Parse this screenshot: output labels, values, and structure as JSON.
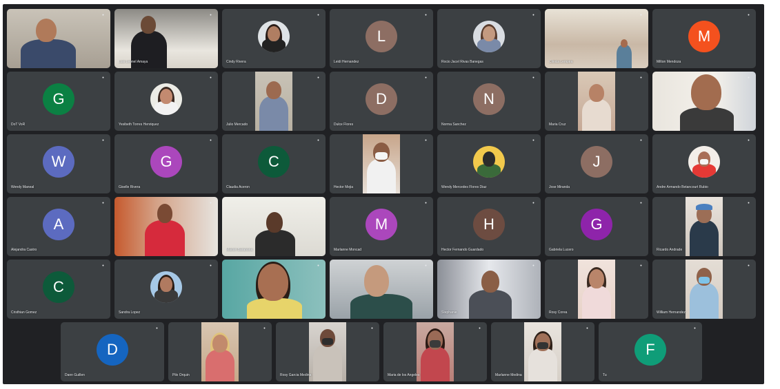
{
  "window": {
    "app": "Video meeting grid"
  },
  "colors": {
    "background": "#202124",
    "tile": "#3c4043",
    "text": "#e8eaed"
  },
  "participants": [
    {
      "name": "",
      "type": "video",
      "style": "office-left"
    },
    {
      "name": "Luis Leonel Amaya",
      "type": "video",
      "style": "office-desk"
    },
    {
      "name": "Cindy Rivera",
      "type": "photo",
      "style": "woman-dark"
    },
    {
      "name": "Leidi Hernandez",
      "type": "avatar",
      "initial": "L",
      "color": "#8d6e63"
    },
    {
      "name": "Rocio Jacel Rivas Banegas",
      "type": "photo",
      "style": "woman-light"
    },
    {
      "name": "Clinica Lempira",
      "type": "video",
      "style": "clinic"
    },
    {
      "name": "Milton Mendoza",
      "type": "avatar",
      "initial": "M",
      "color": "#f4511e"
    },
    {
      "name": "DoT VoR",
      "type": "avatar",
      "initial": "G",
      "color": "#0b8043"
    },
    {
      "name": "Yesibeth Torres Henriquez",
      "type": "photo",
      "style": "woman-glasses"
    },
    {
      "name": "Julio Mercado",
      "type": "video-narrow",
      "style": "man-office"
    },
    {
      "name": "Dulce Flores",
      "type": "avatar",
      "initial": "D",
      "color": "#8d6e63"
    },
    {
      "name": "Norma Sanchez",
      "type": "avatar",
      "initial": "N",
      "color": "#8d6e63"
    },
    {
      "name": "Maria Cruz",
      "type": "video-narrow",
      "style": "woman-room"
    },
    {
      "name": "",
      "type": "video",
      "style": "man-closeup"
    },
    {
      "name": "Wendy Maneal",
      "type": "avatar",
      "initial": "W",
      "color": "#5c6bc0"
    },
    {
      "name": "Giselle Rivera",
      "type": "avatar",
      "initial": "G",
      "color": "#ab47bc"
    },
    {
      "name": "Claudia Aceron",
      "type": "avatar",
      "initial": "C",
      "color": "#0d5a3a"
    },
    {
      "name": "Hector Mejia",
      "type": "video-narrow",
      "style": "man-mask"
    },
    {
      "name": "Wendy Mercedes Flores Diaz",
      "type": "photo",
      "style": "yellow-car"
    },
    {
      "name": "Jose Miranda",
      "type": "avatar",
      "initial": "J",
      "color": "#8d6e63"
    },
    {
      "name": "Andre Armando Betancourt Rubio",
      "type": "photo",
      "style": "man-mask-red"
    },
    {
      "name": "Alejandra Castro",
      "type": "avatar",
      "initial": "A",
      "color": "#5c6bc0"
    },
    {
      "name": "",
      "type": "video",
      "style": "woman-office-red"
    },
    {
      "name": "Marlon Barahona",
      "type": "video",
      "style": "man-whiteboard"
    },
    {
      "name": "Marlanne Moncad",
      "type": "avatar",
      "initial": "M",
      "color": "#ab47bc"
    },
    {
      "name": "Hector Fernando Guardado",
      "type": "avatar",
      "initial": "H",
      "color": "#6d4c41"
    },
    {
      "name": "Gabriela Lucero",
      "type": "avatar",
      "initial": "G",
      "color": "#8e24aa"
    },
    {
      "name": "Ricardo Andrade",
      "type": "video-narrow",
      "style": "man-cap"
    },
    {
      "name": "Cristhian Gomez",
      "type": "avatar",
      "initial": "C",
      "color": "#0d5a3a"
    },
    {
      "name": "Sandra Lopez",
      "type": "photo",
      "style": "couple"
    },
    {
      "name": "",
      "type": "video",
      "style": "woman-closeup"
    },
    {
      "name": "",
      "type": "video",
      "style": "man-car"
    },
    {
      "name": "Stephanie",
      "type": "video",
      "style": "man-curtain"
    },
    {
      "name": "Rosy Corea",
      "type": "video-narrow",
      "style": "woman-pink"
    },
    {
      "name": "William Hernandez",
      "type": "video-narrow",
      "style": "man-mask-blue"
    },
    {
      "name": "Dann Guillen",
      "type": "avatar",
      "initial": "D",
      "color": "#1565c0"
    },
    {
      "name": "Pilo Orquin",
      "type": "video-narrow",
      "style": "woman-blonde"
    },
    {
      "name": "Rosy Garcia Medina",
      "type": "video-narrow",
      "style": "person-mask-dark"
    },
    {
      "name": "Maria de los Angeles",
      "type": "video-narrow",
      "style": "woman-mask-red"
    },
    {
      "name": "Marlanne Medina",
      "type": "video-narrow",
      "style": "woman-mask-home"
    },
    {
      "name": "Tu",
      "type": "avatar",
      "initial": "F",
      "color": "#0f9d78"
    }
  ]
}
